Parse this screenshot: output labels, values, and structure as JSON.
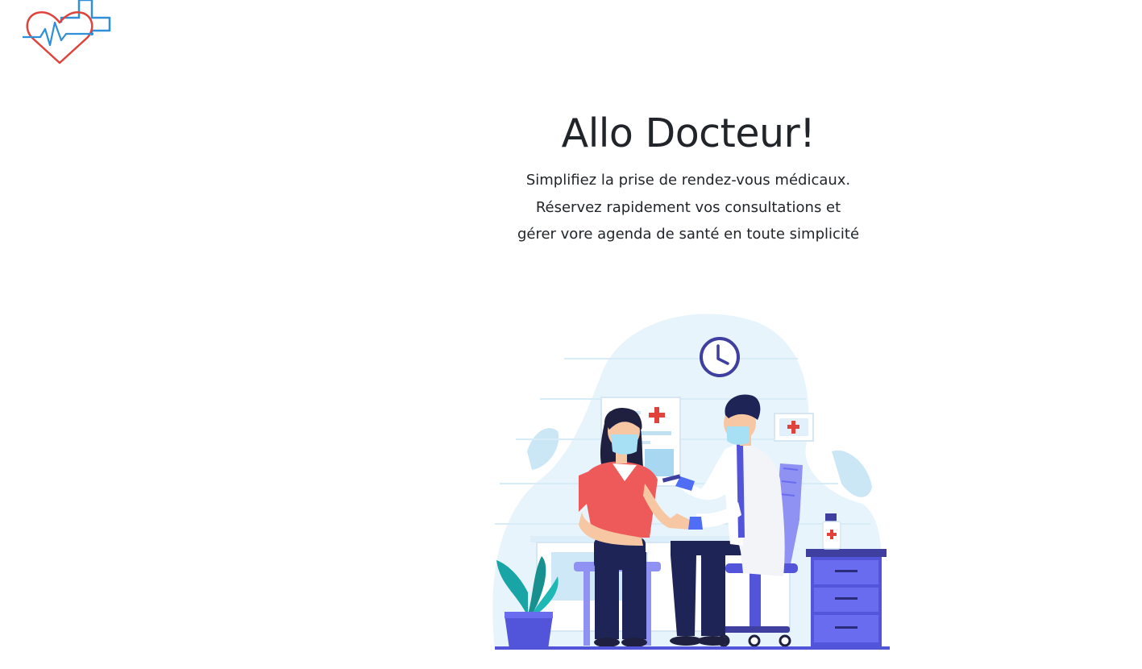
{
  "header": {
    "logo_icon": "heart-cross-heartbeat-icon",
    "logo_colors": {
      "heart": "#e0433b",
      "cross": "#2f8fd8"
    }
  },
  "hero": {
    "title": "Allo Docteur!",
    "tagline_lines": [
      "Simplifiez la prise de rendez-vous médicaux.",
      "Réservez rapidement vos consultations et",
      "gérer vore agenda de santé en toute simplicité"
    ]
  },
  "illustration": {
    "icon": "doctor-vaccinating-patient-illustration",
    "colors": {
      "accent": "#5254d9",
      "background_blob": "#e7f4fb",
      "patient_shirt": "#ee5a5a",
      "cross_red": "#e0433b",
      "plant": "#19a5a5"
    }
  }
}
